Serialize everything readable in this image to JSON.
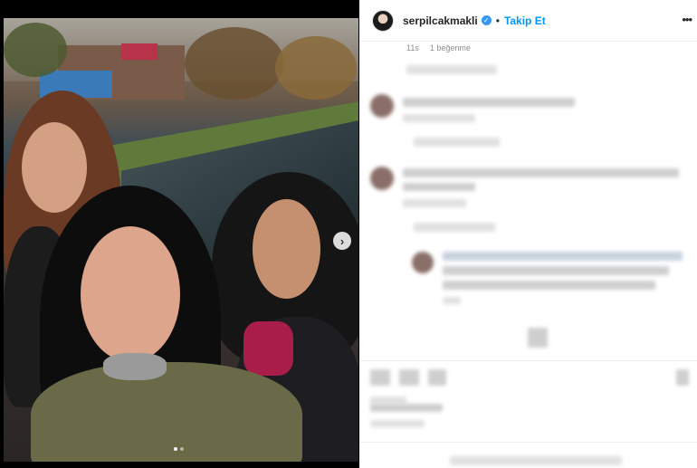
{
  "post": {
    "username": "serpilcakmakli",
    "verified_icon": "verified-badge-icon",
    "separator": "•",
    "follow_label": "Takip Et",
    "more_icon": "more-options-icon",
    "more_glyph": "•••",
    "time": "11s",
    "likes": "1 beğenme"
  },
  "carousel": {
    "next_glyph": "›",
    "slide_count": 2,
    "active_slide": 1
  },
  "colors": {
    "link_blue": "#0095f6",
    "verified_blue": "#3897f0",
    "text": "#262626",
    "muted": "#8e8e8e"
  }
}
